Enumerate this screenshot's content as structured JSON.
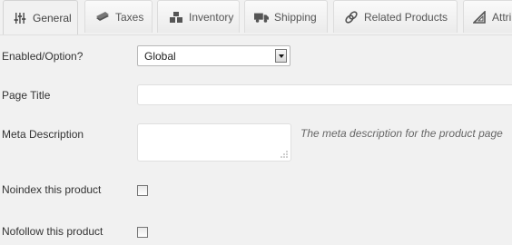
{
  "tabs": [
    {
      "label": "General",
      "icon": "sliders-icon",
      "active": true
    },
    {
      "label": "Taxes",
      "icon": "money-icon",
      "active": false
    },
    {
      "label": "Inventory",
      "icon": "boxes-icon",
      "active": false
    },
    {
      "label": "Shipping",
      "icon": "truck-icon",
      "active": false
    },
    {
      "label": "Related Products",
      "icon": "link-icon",
      "active": false
    },
    {
      "label": "Attrib",
      "icon": "set-square-icon",
      "active": false
    }
  ],
  "form": {
    "enabled": {
      "label": "Enabled/Option?",
      "value": "Global"
    },
    "page_title": {
      "label": "Page Title",
      "value": ""
    },
    "meta_description": {
      "label": "Meta Description",
      "value": "",
      "hint": "The meta description for the product page"
    },
    "noindex": {
      "label": "Noindex this product",
      "checked": false
    },
    "nofollow": {
      "label": "Nofollow this product",
      "checked": false
    }
  }
}
